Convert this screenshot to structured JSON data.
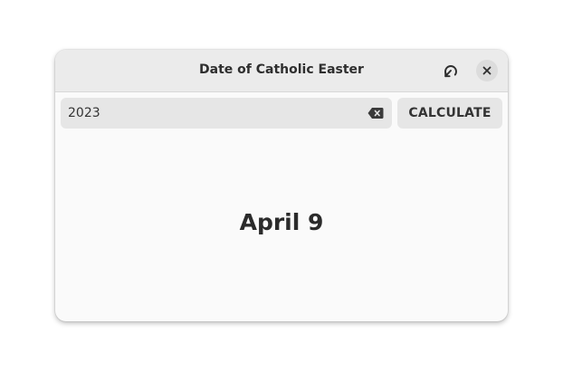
{
  "window": {
    "title": "Date of Catholic Easter"
  },
  "headerbar": {
    "refresh_icon": "refresh-icon",
    "close_icon": "close-icon"
  },
  "input": {
    "value": "2023",
    "clear_icon": "clear-text-icon"
  },
  "buttons": {
    "calculate_label": "CALCULATE"
  },
  "result": {
    "text": "April 9"
  },
  "colors": {
    "window_bg": "#fafafa",
    "headerbar_bg": "#ebebeb",
    "entry_bg": "#e6e6e6",
    "text": "#2e2e2e"
  }
}
